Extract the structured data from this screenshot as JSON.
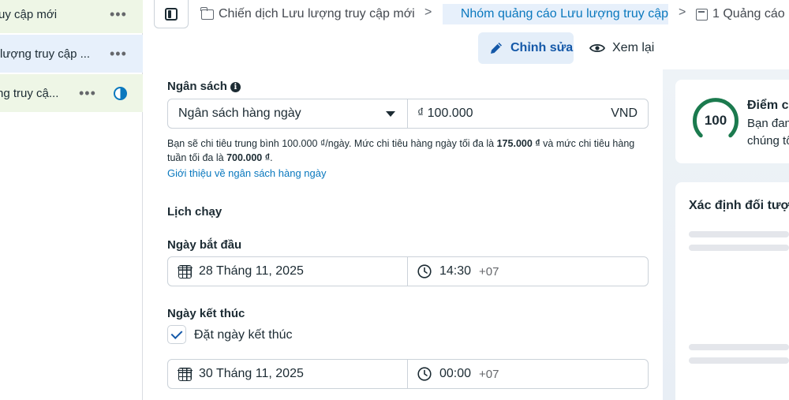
{
  "tree": {
    "row1_label": "uy cập mới",
    "row2_label": "lượng truy cập ...",
    "row3_label": "ng truy cậ...",
    "more_glyph": "•••"
  },
  "breadcrumb": {
    "campaign": "Chiến dịch Lưu lượng truy cập mới",
    "adset": "Nhóm quảng cáo Lưu lượng truy cập",
    "ads": "1 Quảng cáo",
    "separator": ">"
  },
  "tabs": {
    "edit": "Chỉnh sửa",
    "review": "Xem lại"
  },
  "budget": {
    "label": "Ngân sách",
    "info_glyph": "i",
    "type_value": "Ngân sách hàng ngày",
    "amount_value": "₫ 100.000",
    "currency": "VND",
    "help_part1": "Bạn sẽ chi tiêu trung bình 100.000 ₫/ngày. Mức chi tiêu hàng ngày tối đa là ",
    "help_max_daily": "175.000 ₫",
    "help_part2": " và mức chi tiêu hàng tuần tối đa là ",
    "help_max_weekly": "700.000 ₫",
    "help_part3": ".",
    "help_link": "Giới thiệu về ngân sách hàng ngày"
  },
  "schedule": {
    "label": "Lịch chạy",
    "start_label": "Ngày bắt đầu",
    "start_date": "28 Tháng 11, 2025",
    "start_time": "14:30",
    "start_tz": "+07",
    "end_label": "Ngày kết thúc",
    "end_checkbox_label": "Đặt ngày kết thúc",
    "end_checked": true,
    "end_date": "30 Tháng 11, 2025",
    "end_time": "00:00",
    "end_tz": "+07"
  },
  "score": {
    "value": "100",
    "title": "Điểm c",
    "desc_line1": "Bạn đan",
    "desc_line2": "chúng tô",
    "ring_color": "#1b7a4e"
  },
  "audience": {
    "title": "Xác định đối tượ"
  },
  "colors": {
    "accent": "#0a78be",
    "edit_tab_bg": "#e4eef9",
    "edit_tab_text": "#1458a8"
  }
}
